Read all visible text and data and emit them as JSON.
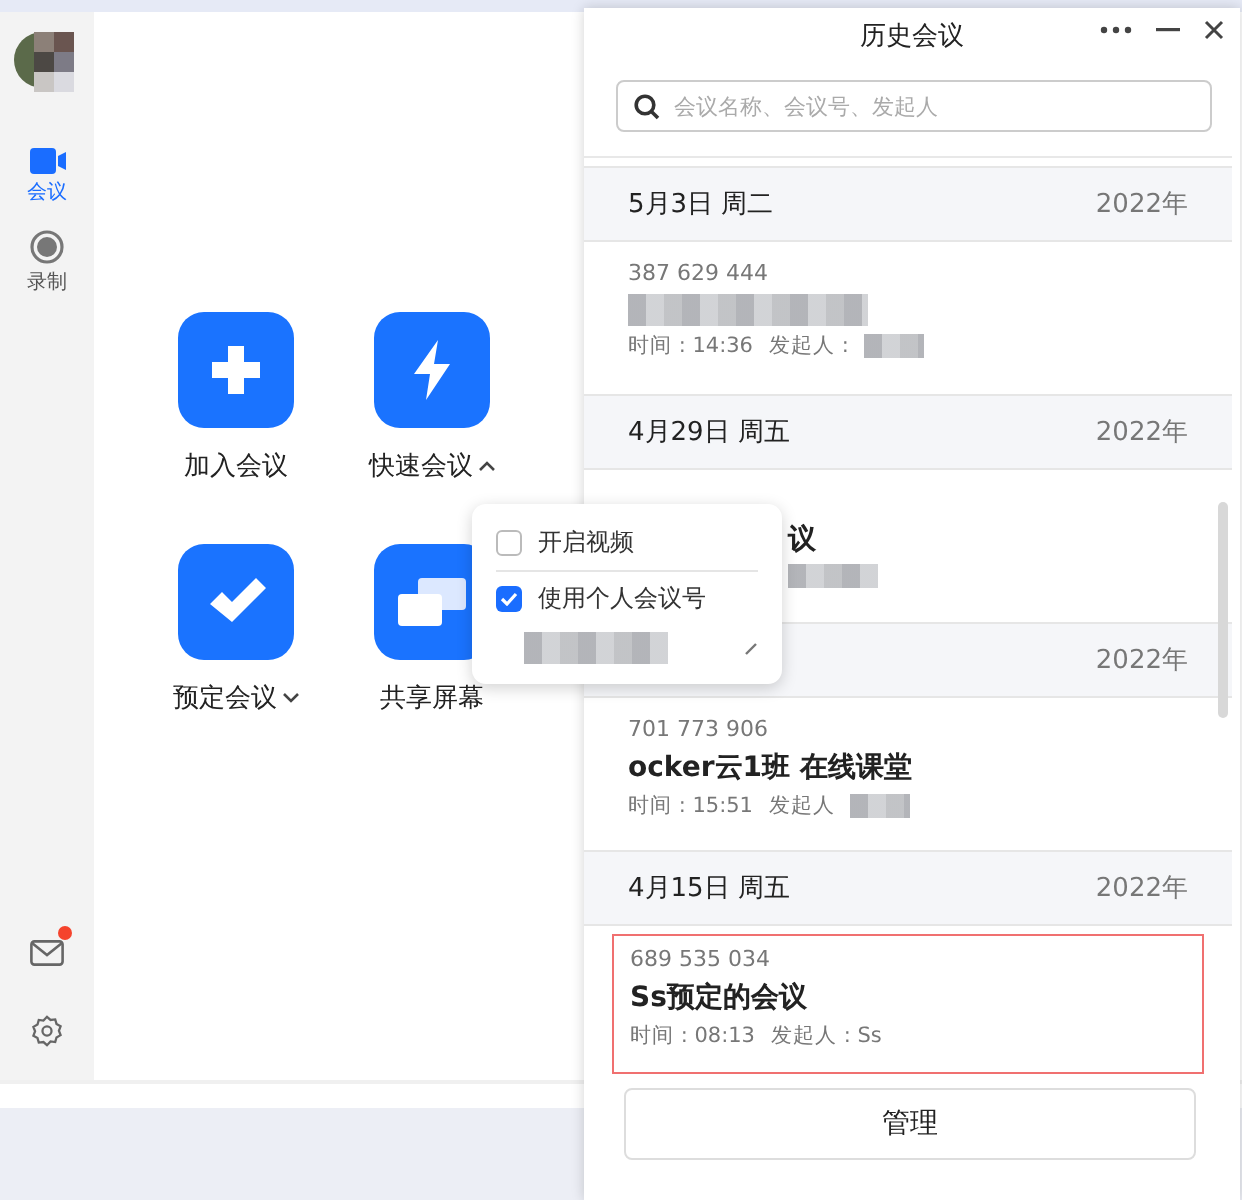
{
  "sidebar": {
    "items": [
      {
        "kind": "video",
        "label": "会议",
        "selected": true
      },
      {
        "kind": "record",
        "label": "录制",
        "selected": false
      }
    ],
    "mail": {
      "unread": true
    }
  },
  "actions": [
    {
      "kind": "plus",
      "label": "加入会议"
    },
    {
      "kind": "bolt",
      "label": "快速会议",
      "expanded": true
    },
    {
      "kind": "check",
      "label": "预定会议",
      "expanded": false
    },
    {
      "kind": "share",
      "label": "共享屏幕"
    }
  ],
  "quick_menu": {
    "options": [
      {
        "label": "开启视频",
        "checked": false
      },
      {
        "label": "使用个人会议号",
        "checked": true
      }
    ]
  },
  "history": {
    "title": "历史会议",
    "search": {
      "placeholder": "会议名称、会议号、发起人"
    },
    "groups": [
      {
        "date": "5月3日 周二",
        "year": "2022年",
        "meetings": [
          {
            "kind": "normal",
            "id": "387 629 444",
            "time": "时间 : 14:36",
            "host": "发起人 :",
            "selected": false
          }
        ]
      },
      {
        "date": "4月29日 周五",
        "year": "2022年",
        "meetings": [
          {
            "kind": "covered",
            "title": "议",
            "selected": false
          }
        ]
      },
      {
        "year": "2022年",
        "meetings": [
          {
            "kind": "normal",
            "id": "701 773 906",
            "title": "ocker云1班 在线课堂",
            "time": "时间 : 15:51",
            "host": "发起人",
            "selected": false
          }
        ]
      },
      {
        "date": "4月15日 周五",
        "year": "2022年",
        "meetings": [
          {
            "kind": "normal",
            "id": "689 535 034",
            "title": "Ss预定的会议",
            "time": "时间 : 08:13",
            "host": "发起人 : Ss",
            "selected": true
          }
        ]
      }
    ],
    "manage_button": "管理"
  }
}
